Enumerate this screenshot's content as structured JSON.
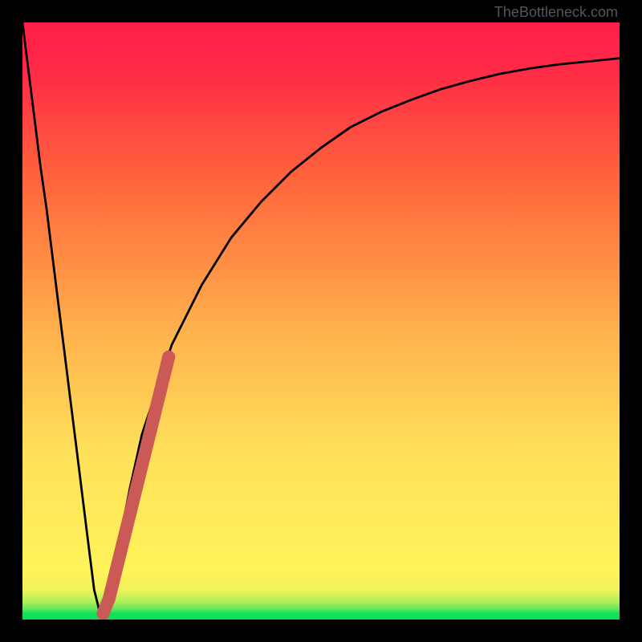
{
  "watermark": "TheBottleneck.com",
  "colors": {
    "strip_green": "#0fe05a",
    "strip_lime": "#b8f25a",
    "strip_yellow": "#fff35a",
    "strip_orange_light": "#ffb24d",
    "strip_orange": "#ff7d3e",
    "strip_red": "#ff3241",
    "strip_red_deep": "#ff1f4a",
    "curve_overlay": "#cb5a56"
  },
  "chart_data": {
    "type": "line",
    "title": "",
    "xlabel": "",
    "ylabel": "",
    "xlim": [
      0,
      100
    ],
    "ylim": [
      0,
      100
    ],
    "x": [
      0,
      1,
      2,
      3,
      4,
      5,
      6,
      7,
      8,
      9,
      10,
      11,
      12,
      13,
      14,
      15,
      16,
      17,
      18,
      19,
      20,
      25,
      30,
      35,
      40,
      45,
      50,
      55,
      60,
      65,
      70,
      75,
      80,
      85,
      90,
      95,
      100
    ],
    "y": [
      100,
      92,
      84,
      76,
      69,
      61,
      53,
      45,
      37,
      29,
      21,
      13,
      5,
      1,
      2.5,
      7,
      12,
      17,
      22,
      26.5,
      31,
      46,
      56,
      64,
      70,
      75,
      79,
      82.5,
      85,
      87,
      88.8,
      90.2,
      91.4,
      92.3,
      93,
      93.5,
      94
    ],
    "overlay_segment": {
      "x": [
        13.5,
        14.5,
        24.5
      ],
      "y": [
        1,
        3.5,
        44
      ]
    },
    "gradient_bands": [
      {
        "start": 0,
        "end": 1,
        "color": "#0fe05a"
      },
      {
        "start": 1,
        "end": 2.5,
        "color": "#65e85a"
      },
      {
        "start": 2.5,
        "end": 4,
        "color": "#aef05a"
      },
      {
        "start": 4,
        "end": 7,
        "color": "#f2f25a"
      },
      {
        "start": 7,
        "end": 25,
        "color_start": "#fff35a",
        "color_end": "#ffe05a"
      },
      {
        "start": 25,
        "end": 45,
        "color_start": "#ffe05a",
        "color_end": "#ffb24d"
      },
      {
        "start": 45,
        "end": 70,
        "color_start": "#ffb24d",
        "color_end": "#ff6a3c"
      },
      {
        "start": 70,
        "end": 100,
        "color_start": "#ff6a3c",
        "color_end": "#ff1f4a"
      }
    ]
  }
}
